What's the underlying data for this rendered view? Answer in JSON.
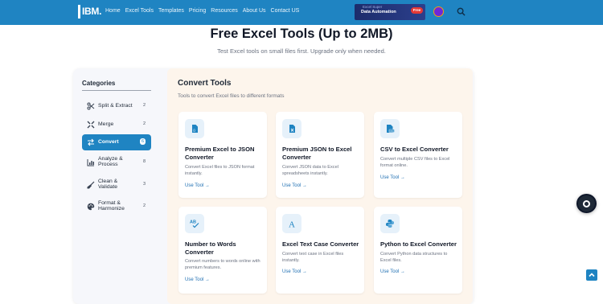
{
  "header": {
    "logo": "IBM.",
    "nav": [
      "Home",
      "Excel Tools",
      "Templates",
      "Pricing",
      "Resources",
      "About Us",
      "Contact US"
    ],
    "promo_text": "Data Automation",
    "promo_sub": "Excel Super",
    "promo_badge": "Free"
  },
  "page": {
    "title": "Free Excel Tools (Up to 2MB)",
    "subtitle": "Test Excel tools on small files first. Upgrade only when needed."
  },
  "sidebar": {
    "title": "Categories",
    "items": [
      {
        "label": "Split & Extract",
        "count": "2",
        "icon": "scissors-icon"
      },
      {
        "label": "Merge",
        "count": "2",
        "icon": "merge-icon"
      },
      {
        "label": "Convert",
        "count": "6",
        "icon": "convert-arrows-icon",
        "active": true
      },
      {
        "label": "Analyze & Process",
        "count": "8",
        "icon": "chart-icon"
      },
      {
        "label": "Clean & Validate",
        "count": "3",
        "icon": "broom-icon"
      },
      {
        "label": "Format & Harmonize",
        "count": "2",
        "icon": "palette-icon"
      }
    ]
  },
  "content": {
    "title": "Convert Tools",
    "description": "Tools to convert Excel files to different formats",
    "cards": [
      {
        "title": "Premium Excel to JSON Converter",
        "desc": "Convert Excel files to JSON format instantly.",
        "link": "Use Tool →",
        "icon": "file-json-icon"
      },
      {
        "title": "Premium JSON to Excel Converter",
        "desc": "Convert JSON data to Excel spreadsheets instantly.",
        "link": "Use Tool →",
        "icon": "file-excel-icon"
      },
      {
        "title": "CSV to Excel Converter",
        "desc": "Convert multiple CSV files to Excel format online.",
        "link": "Use Tool →",
        "icon": "file-csv-icon"
      },
      {
        "title": "Number to Words Converter",
        "desc": "Convert numbers to words online with premium features.",
        "link": "Use Tool →",
        "icon": "spellcheck-icon"
      },
      {
        "title": "Excel Text Case Converter",
        "desc": "Convert text case in Excel files instantly.",
        "link": "Use Tool →",
        "icon": "font-case-icon"
      },
      {
        "title": "Python to Excel Converter",
        "desc": "Convert Python data structures to Excel files.",
        "link": "Use Tool →",
        "icon": "python-icon"
      }
    ]
  },
  "colors": {
    "primary": "#1f84c2",
    "content_bg": "#fdf5ec",
    "sidebar_bg": "#f6f7fb"
  }
}
